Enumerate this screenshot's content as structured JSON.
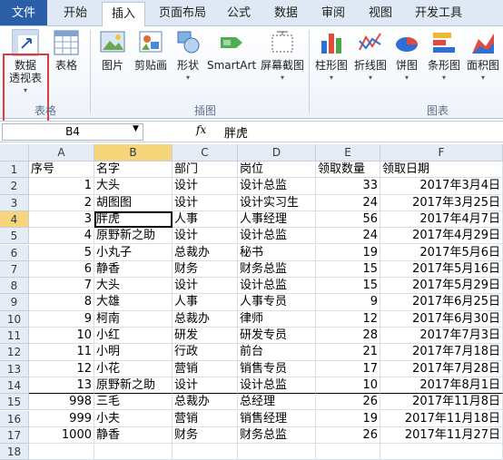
{
  "tabs": [
    {
      "label": "文件"
    },
    {
      "label": "开始"
    },
    {
      "label": "插入"
    },
    {
      "label": "页面布局"
    },
    {
      "label": "公式"
    },
    {
      "label": "数据"
    },
    {
      "label": "审阅"
    },
    {
      "label": "视图"
    },
    {
      "label": "开发工具"
    }
  ],
  "ribbon": {
    "pivot_label_1": "数据",
    "pivot_label_2": "透视表",
    "table_label": "表格",
    "group_table": "表格",
    "picture_label": "图片",
    "clipart_label": "剪贴画",
    "shapes_label": "形状",
    "smartart_label": "SmartArt",
    "screenshot_label": "屏幕截图",
    "group_illustrations": "插图",
    "column_label": "柱形图",
    "line_label": "折线图",
    "pie_label": "饼图",
    "bar_label": "条形图",
    "area_label": "面积图",
    "group_charts": "图表"
  },
  "formula_bar": {
    "name_box": "B4",
    "fx": "fx",
    "value": "胖虎"
  },
  "columns": [
    "A",
    "B",
    "C",
    "D",
    "E",
    "F"
  ],
  "rows": [
    [
      "序号",
      "名字",
      "部门",
      "岗位",
      "领取数量",
      "领取日期"
    ],
    [
      "1",
      "大头",
      "设计",
      "设计总监",
      "33",
      "2017年3月4日"
    ],
    [
      "2",
      "胡图图",
      "设计",
      "设计实习生",
      "24",
      "2017年3月25日"
    ],
    [
      "3",
      "胖虎",
      "人事",
      "人事经理",
      "56",
      "2017年4月7日"
    ],
    [
      "4",
      "原野新之助",
      "设计",
      "设计总监",
      "24",
      "2017年4月29日"
    ],
    [
      "5",
      "小丸子",
      "总裁办",
      "秘书",
      "19",
      "2017年5月6日"
    ],
    [
      "6",
      "静香",
      "财务",
      "财务总监",
      "15",
      "2017年5月16日"
    ],
    [
      "7",
      "大头",
      "设计",
      "设计总监",
      "15",
      "2017年5月29日"
    ],
    [
      "8",
      "大雄",
      "人事",
      "人事专员",
      "9",
      "2017年6月25日"
    ],
    [
      "9",
      "柯南",
      "总裁办",
      "律师",
      "12",
      "2017年6月30日"
    ],
    [
      "10",
      "小红",
      "研发",
      "研发专员",
      "28",
      "2017年7月3日"
    ],
    [
      "11",
      "小明",
      "行政",
      "前台",
      "21",
      "2017年7月18日"
    ],
    [
      "12",
      "小花",
      "营销",
      "销售专员",
      "17",
      "2017年7月28日"
    ],
    [
      "13",
      "原野新之助",
      "设计",
      "设计总监",
      "10",
      "2017年8月1日"
    ],
    [
      "998",
      "三毛",
      "总裁办",
      "总经理",
      "26",
      "2017年11月8日"
    ],
    [
      "999",
      "小夫",
      "营销",
      "销售经理",
      "19",
      "2017年11月18日"
    ],
    [
      "1000",
      "静香",
      "财务",
      "财务总监",
      "26",
      "2017年11月27日"
    ],
    [
      "",
      "",
      "",
      "",
      "",
      ""
    ]
  ],
  "row_numbers": [
    "1",
    "2",
    "3",
    "4",
    "5",
    "6",
    "7",
    "8",
    "9",
    "10",
    "11",
    "12",
    "13",
    "14",
    "15",
    "16",
    "17",
    "18"
  ],
  "selected_cell": "B4",
  "colors": {
    "file_tab": "#2a5fa7",
    "highlight": "#e23a3a",
    "selected_header": "#f7d67b"
  }
}
